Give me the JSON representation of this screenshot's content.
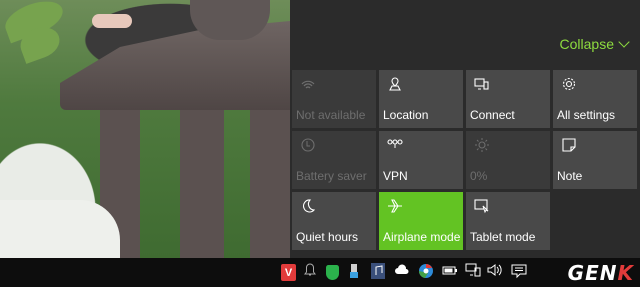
{
  "action_center": {
    "collapse_label": "Collapse",
    "collapse_icon": "chevron-down-icon",
    "accent_color": "#8edc3f",
    "tiles": [
      {
        "label": "Not available",
        "icon": "wifi-icon",
        "state": "disabled"
      },
      {
        "label": "Location",
        "icon": "location-icon",
        "state": "normal"
      },
      {
        "label": "Connect",
        "icon": "connect-icon",
        "state": "normal"
      },
      {
        "label": "All settings",
        "icon": "gear-icon",
        "state": "normal"
      },
      {
        "label": "Battery saver",
        "icon": "battery-saver-icon",
        "state": "disabled"
      },
      {
        "label": "VPN",
        "icon": "vpn-icon",
        "state": "normal"
      },
      {
        "label": "0%",
        "icon": "brightness-icon",
        "state": "disabled"
      },
      {
        "label": "Note",
        "icon": "note-icon",
        "state": "normal"
      },
      {
        "label": "Quiet hours",
        "icon": "moon-icon",
        "state": "normal"
      },
      {
        "label": "Airplane mode",
        "icon": "airplane-icon",
        "state": "active"
      },
      {
        "label": "Tablet mode",
        "icon": "tablet-mode-icon",
        "state": "normal"
      }
    ]
  },
  "taskbar": {
    "tray_icons": [
      "vivaldi-icon",
      "notification-bell-icon",
      "shield-icon",
      "usb-icon",
      "music-icon",
      "onedrive-icon",
      "chrome-icon",
      "battery-icon",
      "network-icon",
      "volume-icon",
      "action-center-icon"
    ],
    "vivaldi_letter": "V",
    "watermark_gen": "GEN",
    "watermark_k": "K"
  }
}
